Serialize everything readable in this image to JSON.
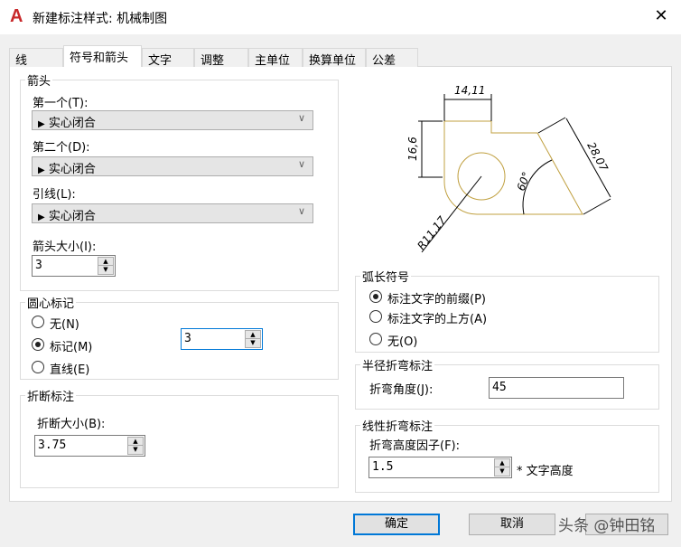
{
  "window": {
    "title": "新建标注样式: 机械制图",
    "logo": "A",
    "close_icon": "close-icon"
  },
  "tabs": [
    "线",
    "符号和箭头",
    "文字",
    "调整",
    "主单位",
    "换算单位",
    "公差"
  ],
  "arrows": {
    "group": "箭头",
    "first_label": "第一个(T):",
    "first_value": "实心闭合",
    "second_label": "第二个(D):",
    "second_value": "实心闭合",
    "leader_label": "引线(L):",
    "leader_value": "实心闭合",
    "size_label": "箭头大小(I):",
    "size_value": "3"
  },
  "center_marks": {
    "group": "圆心标记",
    "none": "无(N)",
    "mark": "标记(M)",
    "line": "直线(E)",
    "selected": "mark",
    "size_value": "3"
  },
  "break": {
    "group": "折断标注",
    "size_label": "折断大小(B):",
    "size_value": "3.75"
  },
  "preview": {
    "dim_top": "14,11",
    "dim_left": "16,6",
    "dim_right": "28,07",
    "dim_angle": "60°",
    "dim_radius": "R11,17",
    "line_color": "#c0a040"
  },
  "arc_length": {
    "group": "弧长符号",
    "prefix": "标注文字的前缀(P)",
    "above": "标注文字的上方(A)",
    "none": "无(O)",
    "selected": "prefix"
  },
  "radius_jog": {
    "group": "半径折弯标注",
    "angle_label": "折弯角度(J):",
    "angle_value": "45"
  },
  "linear_jog": {
    "group": "线性折弯标注",
    "factor_label": "折弯高度因子(F):",
    "factor_value": "1.5",
    "suffix": "* 文字高度"
  },
  "buttons": {
    "ok": "确定",
    "cancel": "取消"
  },
  "watermark": "头条 @钟田铭"
}
